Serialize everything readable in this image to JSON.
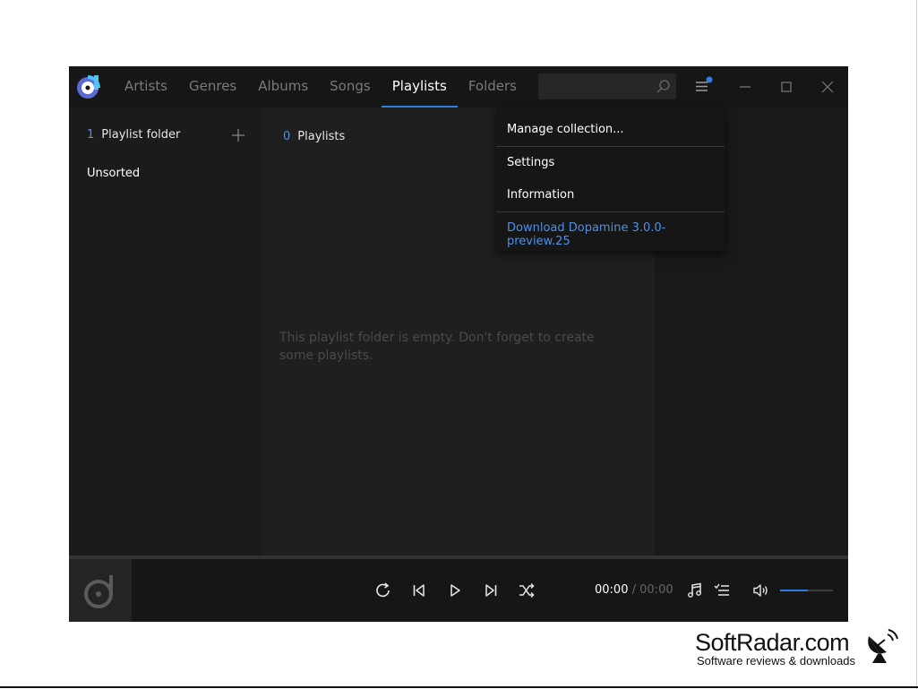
{
  "nav": {
    "tabs": [
      {
        "label": "Artists",
        "active": false
      },
      {
        "label": "Genres",
        "active": false
      },
      {
        "label": "Albums",
        "active": false
      },
      {
        "label": "Songs",
        "active": false
      },
      {
        "label": "Playlists",
        "active": true
      },
      {
        "label": "Folders",
        "active": false
      }
    ]
  },
  "search": {
    "placeholder": ""
  },
  "left_panel": {
    "count": "1",
    "label": "Playlist folder",
    "folders": [
      "Unsorted"
    ]
  },
  "main": {
    "count": "0",
    "label": "Playlists",
    "empty_message": "This playlist folder is empty. Don't forget to create some playlists."
  },
  "menu": {
    "items": [
      "Manage collection...",
      "Settings",
      "Information"
    ],
    "download_label": "Download Dopamine 3.0.0-preview.25"
  },
  "player": {
    "current_time": "00:00",
    "separator": "/",
    "total_time": "00:00",
    "volume_level": 0.53
  },
  "watermark": {
    "title": "SoftRadar.com",
    "subtitle": "Software reviews & downloads"
  },
  "colors": {
    "accent": "#2f7de1",
    "background": "#1b1b1b",
    "titlebar": "#161616"
  }
}
